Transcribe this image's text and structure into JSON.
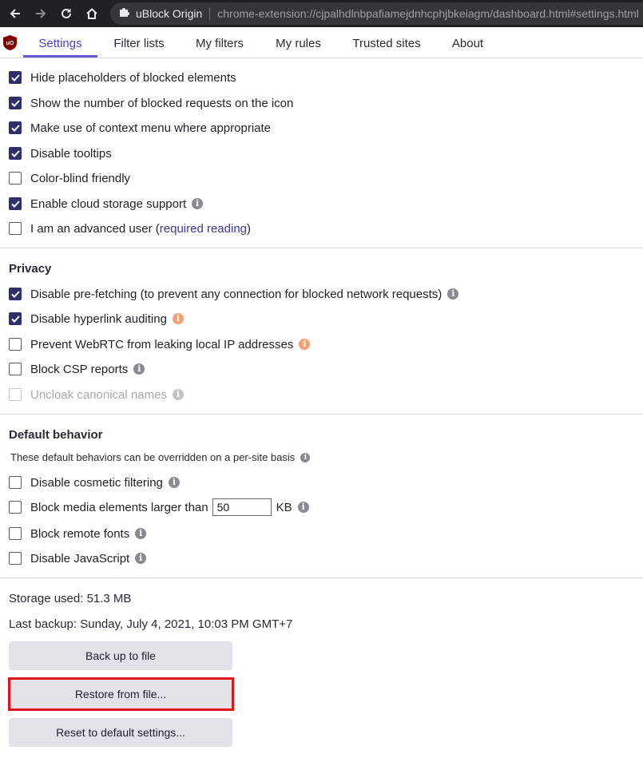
{
  "browser": {
    "extension_name": "uBlock Origin",
    "url": "chrome-extension://cjpalhdlnbpafiamejdnhcphjbkeiagm/dashboard.html#settings.html"
  },
  "tabs": [
    {
      "label": "Settings",
      "active": true
    },
    {
      "label": "Filter lists"
    },
    {
      "label": "My filters"
    },
    {
      "label": "My rules"
    },
    {
      "label": "Trusted sites"
    },
    {
      "label": "About"
    }
  ],
  "appearance": {
    "items": [
      {
        "label": "Hide placeholders of blocked elements",
        "checked": true
      },
      {
        "label": "Show the number of blocked requests on the icon",
        "checked": true
      },
      {
        "label": "Make use of context menu where appropriate",
        "checked": true
      },
      {
        "label": "Disable tooltips",
        "checked": true
      },
      {
        "label": "Color-blind friendly",
        "checked": false
      },
      {
        "label": "Enable cloud storage support",
        "checked": true,
        "info": true
      },
      {
        "label": "I am an advanced user",
        "checked": false,
        "link_text": "required reading"
      }
    ]
  },
  "privacy": {
    "heading": "Privacy",
    "items": [
      {
        "label": "Disable pre-fetching (to prevent any connection for blocked network requests)",
        "checked": true
      },
      {
        "label": "Disable hyperlink auditing",
        "checked": true
      },
      {
        "label": "Prevent WebRTC from leaking local IP addresses",
        "checked": false
      },
      {
        "label": "Block CSP reports",
        "checked": false
      },
      {
        "label": "Uncloak canonical names",
        "checked": false,
        "disabled": true
      }
    ]
  },
  "default_behavior": {
    "heading": "Default behavior",
    "note": "These default behaviors can be overridden on a per-site basis",
    "items": [
      {
        "label": "Disable cosmetic filtering",
        "checked": false
      },
      {
        "label": "Block media elements larger than",
        "checked": false,
        "input_value": "50",
        "unit": "KB"
      },
      {
        "label": "Block remote fonts",
        "checked": false
      },
      {
        "label": "Disable JavaScript",
        "checked": false
      }
    ]
  },
  "storage": {
    "used": "Storage used: 51.3 MB",
    "last_backup": "Last backup: Sunday, July 4, 2021, 10:03 PM GMT+7",
    "buttons": {
      "backup": "Back up to file",
      "restore": "Restore from file...",
      "reset": "Reset to default settings..."
    }
  },
  "colors": {
    "accent": "#6655d6",
    "checkbox_checked": "#2f2f6e",
    "warning_info": "#f4a074",
    "highlight": "#e0141b"
  }
}
